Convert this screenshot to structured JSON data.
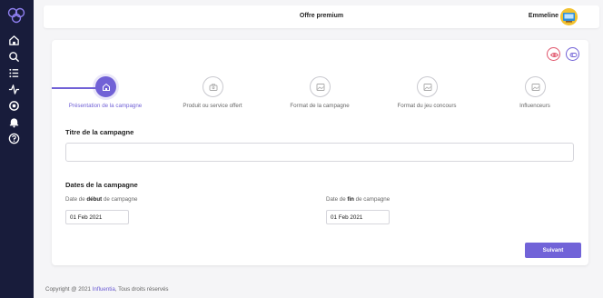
{
  "colors": {
    "sidebar": "#181c3b",
    "accent": "#7161d6",
    "preview_red": "#e0556b"
  },
  "sidebar": {
    "logo": "logo-icon",
    "items": [
      {
        "icon": "home-icon"
      },
      {
        "icon": "search-icon"
      },
      {
        "icon": "list-icon"
      },
      {
        "icon": "activity-icon"
      },
      {
        "icon": "settings-icon"
      },
      {
        "icon": "bell-icon"
      },
      {
        "icon": "help-icon"
      }
    ]
  },
  "topbar": {
    "title": "Offre premium",
    "username": "Emmeline",
    "avatar": "avatar-icon"
  },
  "card": {
    "actions": [
      {
        "icon": "eye-icon"
      },
      {
        "icon": "eye-off-icon"
      }
    ],
    "steps": [
      {
        "label": "Présentation de la campagne",
        "icon": "home-icon",
        "active": true
      },
      {
        "label": "Produit ou service offert",
        "icon": "briefcase-icon",
        "active": false
      },
      {
        "label": "Format de la campagne",
        "icon": "image-icon",
        "active": false
      },
      {
        "label": "Format du jeu concours",
        "icon": "image-icon",
        "active": false
      },
      {
        "label": "Influenceurs",
        "icon": "image-icon",
        "active": false
      }
    ],
    "title_section": {
      "label": "Titre de la campagne",
      "value": ""
    },
    "dates_section": {
      "label": "Dates de la campagne",
      "start": {
        "label_prefix": "Date de ",
        "label_bold": "début",
        "label_suffix": " de campagne",
        "value": "01 Feb 2021"
      },
      "end": {
        "label_prefix": "Date de ",
        "label_bold": "fin",
        "label_suffix": " de campagne",
        "value": "01 Feb 2021"
      }
    },
    "next_button": "Suivant"
  },
  "footer": {
    "prefix": "Copyright @ 2021 ",
    "brand": "Influentia",
    "suffix": ", Tous droits réservés"
  }
}
